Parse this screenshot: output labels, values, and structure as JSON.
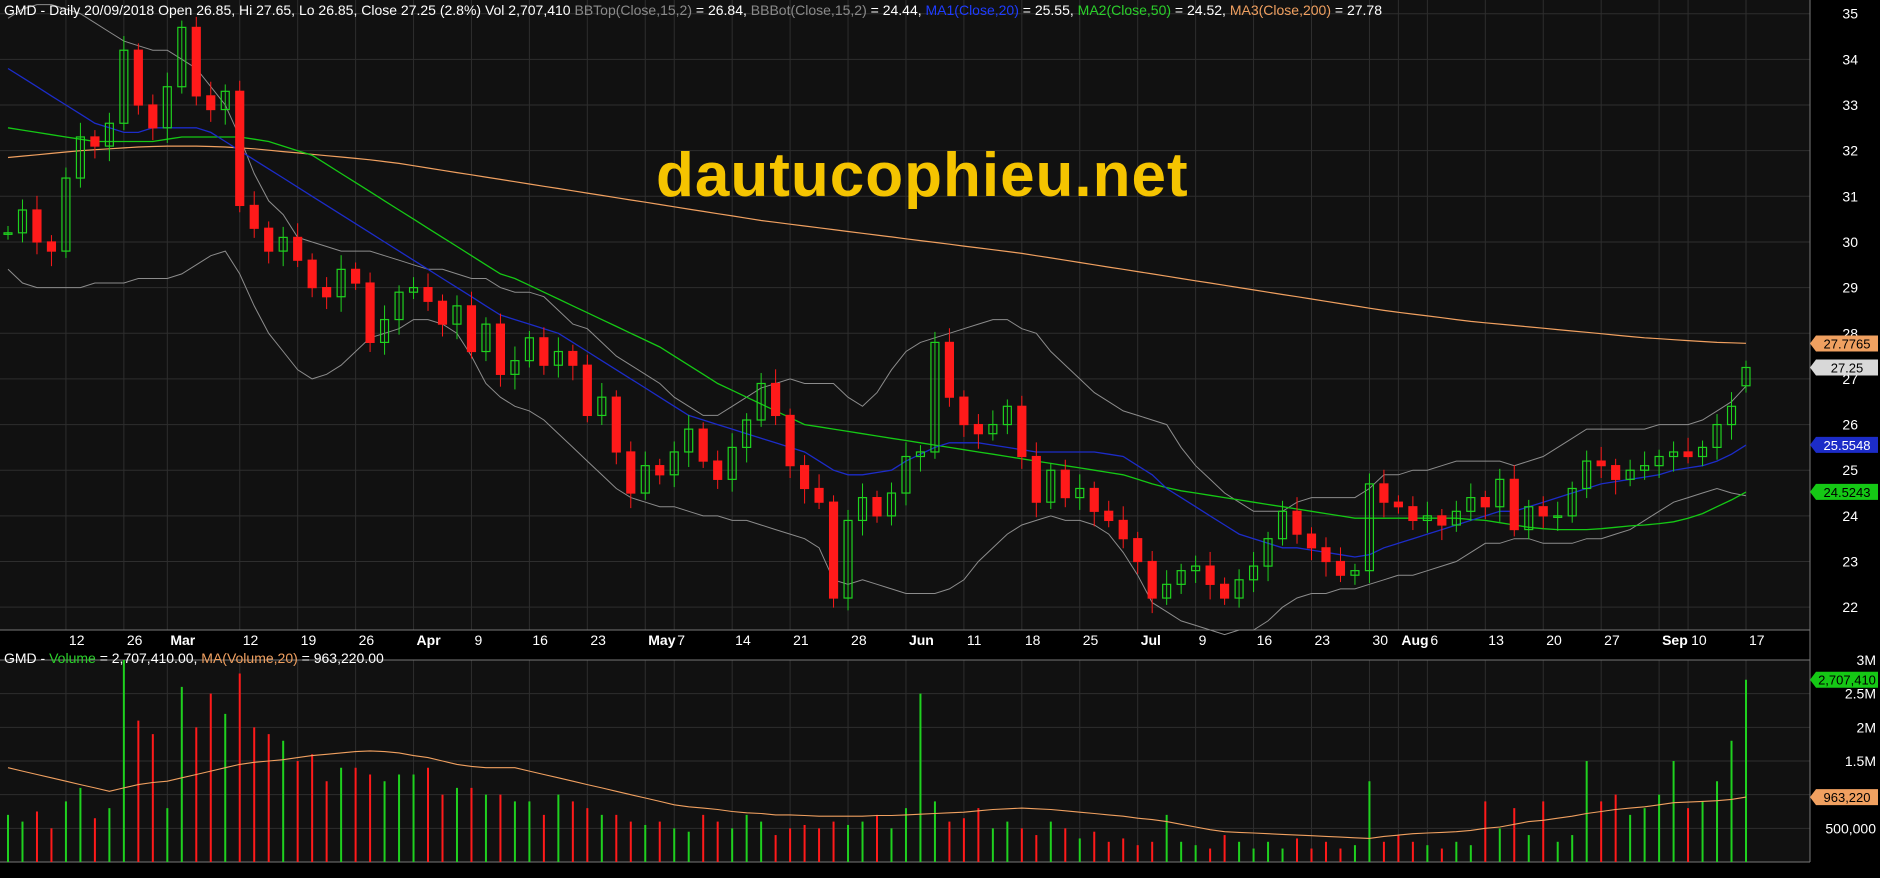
{
  "header": {
    "symbol_line": "GMD - Daily 20/09/2018 Open 26.85, Hi 27.65, Lo 26.85, Close 27.25 (2.8%) Vol 2,707,410",
    "bbtop_label": "BBTop(Close,15,2)",
    "bbtop_value": " = 26.84, ",
    "bbbot_label": "BBBot(Close,15,2)",
    "bbbot_value": " = 24.44, ",
    "ma1_label": "MA1(Close,20)",
    "ma1_value": " = 25.55, ",
    "ma2_label": "MA2(Close,50)",
    "ma2_value": " = 24.52, ",
    "ma3_label": "MA3(Close,200)",
    "ma3_value": " = 27.78"
  },
  "volume_header": {
    "symbol": "GMD - ",
    "volume_label": "Volume",
    "volume_value": " = 2,707,410.00, ",
    "ma_label": "MA(Volume,20)",
    "ma_value": " = 963,220.00"
  },
  "watermark": "dautucophieu.net",
  "colors": {
    "up": "#1fd11f",
    "down": "#ff1a1a",
    "bb": "#8c8c8c",
    "ma1": "#1c2cc8",
    "ma2": "#15c815",
    "ma3": "#f0a060",
    "vol_ma": "#f0a060",
    "grid": "#2e2e2e"
  },
  "chart_data": {
    "type": "candlestick",
    "price_axis": {
      "range": [
        21.5,
        35.3
      ],
      "ticks": [
        "22",
        "23",
        "24",
        "25",
        "26",
        "27",
        "28",
        "29",
        "30",
        "31",
        "32",
        "33",
        "34",
        "35"
      ]
    },
    "volume_axis": {
      "range": [
        0,
        3000000
      ],
      "ticks": [
        {
          "value": 500000,
          "label": "500,000"
        },
        {
          "value": 1000000,
          "label": "1M"
        },
        {
          "value": 1500000,
          "label": "1.5M"
        },
        {
          "value": 2000000,
          "label": "2M"
        },
        {
          "value": 2500000,
          "label": "2.5M"
        },
        {
          "value": 3000000,
          "label": "3M"
        }
      ]
    },
    "x_labels": [
      {
        "i": 4,
        "t": "12"
      },
      {
        "i": 8,
        "t": "26"
      },
      {
        "i": 11,
        "t": "Mar"
      },
      {
        "i": 16,
        "t": "12"
      },
      {
        "i": 20,
        "t": "19"
      },
      {
        "i": 24,
        "t": "26"
      },
      {
        "i": 28,
        "t": "Apr"
      },
      {
        "i": 32,
        "t": "9"
      },
      {
        "i": 36,
        "t": "16"
      },
      {
        "i": 40,
        "t": "23"
      },
      {
        "i": 44,
        "t": "May"
      },
      {
        "i": 46,
        "t": "7"
      },
      {
        "i": 50,
        "t": "14"
      },
      {
        "i": 54,
        "t": "21"
      },
      {
        "i": 58,
        "t": "28"
      },
      {
        "i": 62,
        "t": "Jun"
      },
      {
        "i": 66,
        "t": "11"
      },
      {
        "i": 70,
        "t": "18"
      },
      {
        "i": 74,
        "t": "25"
      },
      {
        "i": 78,
        "t": "Jul"
      },
      {
        "i": 82,
        "t": "9"
      },
      {
        "i": 86,
        "t": "16"
      },
      {
        "i": 90,
        "t": "23"
      },
      {
        "i": 94,
        "t": "30"
      },
      {
        "i": 96,
        "t": "Aug"
      },
      {
        "i": 98,
        "t": "6"
      },
      {
        "i": 102,
        "t": "13"
      },
      {
        "i": 106,
        "t": "20"
      },
      {
        "i": 110,
        "t": "27"
      },
      {
        "i": 114,
        "t": "Sep"
      },
      {
        "i": 116,
        "t": "10"
      },
      {
        "i": 120,
        "t": "17"
      }
    ],
    "close": [
      30.2,
      30.7,
      30.0,
      29.8,
      31.4,
      32.3,
      32.1,
      32.6,
      34.2,
      33.0,
      32.5,
      33.4,
      34.7,
      33.2,
      32.9,
      33.3,
      30.8,
      30.3,
      29.8,
      30.1,
      29.6,
      29.0,
      28.8,
      29.4,
      29.1,
      27.8,
      28.3,
      28.9,
      29.0,
      28.7,
      28.2,
      28.6,
      27.6,
      28.2,
      27.1,
      27.4,
      27.9,
      27.3,
      27.6,
      27.3,
      26.2,
      26.6,
      25.4,
      24.5,
      25.1,
      24.9,
      25.4,
      25.9,
      25.2,
      24.8,
      25.5,
      26.1,
      26.9,
      26.2,
      25.1,
      24.6,
      24.3,
      22.2,
      23.9,
      24.4,
      24.0,
      24.5,
      25.3,
      25.4,
      27.8,
      26.6,
      26.0,
      25.8,
      26.0,
      26.4,
      25.3,
      24.3,
      25.0,
      24.4,
      24.6,
      24.1,
      23.9,
      23.5,
      23.0,
      22.2,
      22.5,
      22.8,
      22.9,
      22.5,
      22.2,
      22.6,
      22.9,
      23.5,
      24.1,
      23.6,
      23.3,
      23.0,
      22.7,
      22.8,
      24.7,
      24.3,
      24.2,
      23.9,
      24.0,
      23.8,
      24.1,
      24.4,
      24.2,
      24.8,
      23.7,
      24.2,
      24.0,
      24.0,
      24.6,
      25.2,
      25.1,
      24.8,
      25.0,
      25.1,
      25.3,
      25.4,
      25.3,
      25.5,
      26.0,
      26.4,
      27.25
    ],
    "open": [
      null,
      30.2,
      30.7,
      30.0,
      29.8,
      31.4,
      32.3,
      32.1,
      32.6,
      34.2,
      33.0,
      32.5,
      33.4,
      34.7,
      33.2,
      32.9,
      33.3,
      30.8,
      30.3,
      29.8,
      30.1,
      29.6,
      29.0,
      28.8,
      29.4,
      29.1,
      27.8,
      28.3,
      28.9,
      29.0,
      28.7,
      28.2,
      28.6,
      27.6,
      28.2,
      27.1,
      27.4,
      27.9,
      27.3,
      27.6,
      27.3,
      26.2,
      26.6,
      25.4,
      24.5,
      25.1,
      24.9,
      25.4,
      25.9,
      25.2,
      24.8,
      25.5,
      26.1,
      26.9,
      26.2,
      25.1,
      24.6,
      24.3,
      22.2,
      23.9,
      24.4,
      24.0,
      24.5,
      25.3,
      25.4,
      27.8,
      26.6,
      26.0,
      25.8,
      26.0,
      26.4,
      25.3,
      24.3,
      25.0,
      24.4,
      24.6,
      24.1,
      23.9,
      23.5,
      23.0,
      22.2,
      22.5,
      22.8,
      22.9,
      22.5,
      22.2,
      22.6,
      22.9,
      23.5,
      24.1,
      23.6,
      23.3,
      23.0,
      22.7,
      22.8,
      24.7,
      24.3,
      24.2,
      23.9,
      24.0,
      23.8,
      24.1,
      24.4,
      24.2,
      24.8,
      23.7,
      24.2,
      24.0,
      24.0,
      24.6,
      25.2,
      25.1,
      24.8,
      25.0,
      25.1,
      25.3,
      25.4,
      25.3,
      25.5,
      26.0,
      26.85
    ],
    "bb_top": [
      34.9,
      35.1,
      35.2,
      35.2,
      35.1,
      35.0,
      34.8,
      34.6,
      34.4,
      34.3,
      34.2,
      34.2,
      34.0,
      33.8,
      33.4,
      33.0,
      32.3,
      31.5,
      30.9,
      30.6,
      30.1,
      30.0,
      29.9,
      29.8,
      29.8,
      29.8,
      29.7,
      29.6,
      29.5,
      29.4,
      29.4,
      29.3,
      29.2,
      29.2,
      29.0,
      28.9,
      28.9,
      28.8,
      28.5,
      28.2,
      28.1,
      27.8,
      27.5,
      27.3,
      27.1,
      26.9,
      26.6,
      26.4,
      26.2,
      26.2,
      26.4,
      26.6,
      26.8,
      26.9,
      27.0,
      26.9,
      26.9,
      26.9,
      26.6,
      26.4,
      26.7,
      27.2,
      27.6,
      27.8,
      27.9,
      28.0,
      28.1,
      28.2,
      28.3,
      28.3,
      28.1,
      28.0,
      27.6,
      27.3,
      27.0,
      26.7,
      26.5,
      26.3,
      26.2,
      26.1,
      26.0,
      25.5,
      25.1,
      24.8,
      24.5,
      24.3,
      24.1,
      24.1,
      24.1,
      24.3,
      24.4,
      24.4,
      24.4,
      24.4,
      24.6,
      24.9,
      24.9,
      25.0,
      25.0,
      25.1,
      25.2,
      25.2,
      25.2,
      25.2,
      25.1,
      25.2,
      25.3,
      25.5,
      25.7,
      25.9,
      25.9,
      25.9,
      25.9,
      25.9,
      26.0,
      26.0,
      26.0,
      26.1,
      26.3,
      26.5,
      26.84
    ],
    "bb_bot": [
      29.4,
      29.1,
      29.0,
      29.0,
      29.0,
      29.0,
      29.1,
      29.1,
      29.1,
      29.2,
      29.2,
      29.2,
      29.3,
      29.5,
      29.7,
      29.8,
      29.3,
      28.6,
      28.0,
      27.6,
      27.2,
      27.0,
      27.1,
      27.3,
      27.6,
      27.9,
      28.0,
      28.1,
      28.3,
      28.3,
      28.2,
      28.0,
      27.5,
      26.9,
      26.6,
      26.4,
      26.3,
      26.1,
      25.8,
      25.5,
      25.2,
      24.9,
      24.6,
      24.4,
      24.3,
      24.2,
      24.2,
      24.1,
      24.0,
      24.0,
      23.9,
      23.9,
      23.8,
      23.7,
      23.6,
      23.5,
      23.3,
      22.6,
      22.5,
      22.6,
      22.5,
      22.4,
      22.3,
      22.3,
      22.3,
      22.4,
      22.6,
      23.0,
      23.3,
      23.6,
      23.8,
      23.9,
      24.0,
      23.9,
      23.9,
      23.8,
      23.6,
      23.2,
      22.7,
      22.1,
      21.9,
      21.7,
      21.6,
      21.5,
      21.4,
      21.5,
      21.5,
      21.7,
      22.0,
      22.2,
      22.3,
      22.3,
      22.4,
      22.4,
      22.5,
      22.6,
      22.7,
      22.7,
      22.8,
      22.9,
      23.0,
      23.2,
      23.4,
      23.4,
      23.5,
      23.5,
      23.4,
      23.4,
      23.4,
      23.5,
      23.5,
      23.6,
      23.7,
      23.9,
      24.1,
      24.3,
      24.4,
      24.5,
      24.6,
      24.5,
      24.44
    ],
    "ma1": [
      33.8,
      33.6,
      33.4,
      33.2,
      33.0,
      32.8,
      32.6,
      32.5,
      32.4,
      32.4,
      32.5,
      32.5,
      32.5,
      32.5,
      32.4,
      32.2,
      32.0,
      31.8,
      31.6,
      31.4,
      31.2,
      31.0,
      30.8,
      30.6,
      30.4,
      30.2,
      30.0,
      29.8,
      29.6,
      29.4,
      29.2,
      29.0,
      28.8,
      28.6,
      28.4,
      28.3,
      28.2,
      28.1,
      28.0,
      27.8,
      27.6,
      27.4,
      27.2,
      27.0,
      26.8,
      26.6,
      26.4,
      26.2,
      26.1,
      26.0,
      25.9,
      25.8,
      25.7,
      25.6,
      25.5,
      25.4,
      25.2,
      25.0,
      24.9,
      24.9,
      24.95,
      25.0,
      25.2,
      25.35,
      25.5,
      25.6,
      25.6,
      25.6,
      25.55,
      25.5,
      25.45,
      25.4,
      25.4,
      25.4,
      25.4,
      25.4,
      25.35,
      25.3,
      25.1,
      24.9,
      24.6,
      24.4,
      24.2,
      24.0,
      23.8,
      23.6,
      23.5,
      23.4,
      23.3,
      23.3,
      23.25,
      23.2,
      23.15,
      23.1,
      23.15,
      23.3,
      23.4,
      23.5,
      23.6,
      23.7,
      23.8,
      23.9,
      24.0,
      24.1,
      24.1,
      24.2,
      24.3,
      24.4,
      24.5,
      24.6,
      24.7,
      24.75,
      24.8,
      24.85,
      24.9,
      25.0,
      25.05,
      25.1,
      25.2,
      25.35,
      25.55
    ],
    "ma2": [
      32.5,
      32.45,
      32.4,
      32.35,
      32.3,
      32.25,
      32.2,
      32.2,
      32.2,
      32.2,
      32.2,
      32.25,
      32.3,
      32.3,
      32.3,
      32.3,
      32.3,
      32.25,
      32.2,
      32.1,
      32.0,
      31.9,
      31.7,
      31.5,
      31.3,
      31.1,
      30.9,
      30.7,
      30.5,
      30.3,
      30.1,
      29.9,
      29.7,
      29.5,
      29.3,
      29.2,
      29.05,
      28.9,
      28.75,
      28.6,
      28.45,
      28.3,
      28.15,
      28.0,
      27.85,
      27.7,
      27.5,
      27.3,
      27.1,
      26.9,
      26.75,
      26.6,
      26.45,
      26.3,
      26.15,
      26.0,
      25.95,
      25.9,
      25.85,
      25.8,
      25.75,
      25.7,
      25.65,
      25.6,
      25.55,
      25.5,
      25.45,
      25.4,
      25.35,
      25.3,
      25.25,
      25.2,
      25.15,
      25.1,
      25.05,
      25.0,
      24.95,
      24.9,
      24.8,
      24.7,
      24.62,
      24.55,
      24.5,
      24.45,
      24.4,
      24.35,
      24.3,
      24.25,
      24.2,
      24.15,
      24.1,
      24.05,
      24.0,
      23.95,
      23.95,
      23.95,
      23.95,
      23.95,
      23.95,
      23.95,
      23.95,
      23.92,
      23.9,
      23.85,
      23.8,
      23.75,
      23.72,
      23.7,
      23.7,
      23.7,
      23.72,
      23.75,
      23.78,
      23.8,
      23.83,
      23.87,
      23.95,
      24.05,
      24.2,
      24.35,
      24.52
    ],
    "ma3": [
      31.85,
      31.88,
      31.91,
      31.94,
      31.97,
      32.0,
      32.02,
      32.04,
      32.06,
      32.08,
      32.09,
      32.1,
      32.1,
      32.1,
      32.09,
      32.08,
      32.06,
      32.04,
      32.01,
      31.98,
      31.95,
      31.92,
      31.89,
      31.86,
      31.83,
      31.8,
      31.76,
      31.72,
      31.67,
      31.62,
      31.57,
      31.52,
      31.47,
      31.42,
      31.37,
      31.32,
      31.27,
      31.22,
      31.17,
      31.12,
      31.07,
      31.02,
      30.97,
      30.92,
      30.87,
      30.82,
      30.77,
      30.72,
      30.67,
      30.62,
      30.57,
      30.52,
      30.47,
      30.43,
      30.39,
      30.35,
      30.31,
      30.27,
      30.23,
      30.19,
      30.15,
      30.11,
      30.07,
      30.03,
      29.99,
      29.95,
      29.91,
      29.87,
      29.83,
      29.79,
      29.75,
      29.7,
      29.65,
      29.6,
      29.55,
      29.5,
      29.45,
      29.4,
      29.35,
      29.3,
      29.25,
      29.2,
      29.15,
      29.1,
      29.05,
      29.0,
      28.95,
      28.9,
      28.85,
      28.8,
      28.75,
      28.7,
      28.65,
      28.6,
      28.55,
      28.5,
      28.46,
      28.42,
      28.38,
      28.34,
      28.3,
      28.26,
      28.23,
      28.2,
      28.17,
      28.14,
      28.11,
      28.08,
      28.05,
      28.02,
      27.99,
      27.96,
      27.93,
      27.9,
      27.88,
      27.86,
      27.84,
      27.82,
      27.8,
      27.79,
      27.78
    ],
    "volume": [
      700000,
      600000,
      750000,
      500000,
      900000,
      1100000,
      650000,
      800000,
      3000000,
      2100000,
      1900000,
      800000,
      2600000,
      2000000,
      2500000,
      2200000,
      2800000,
      2000000,
      1900000,
      1800000,
      1500000,
      1600000,
      1200000,
      1400000,
      1400000,
      1300000,
      1200000,
      1300000,
      1300000,
      1400000,
      1000000,
      1100000,
      1100000,
      1000000,
      1000000,
      900000,
      900000,
      700000,
      1000000,
      900000,
      800000,
      700000,
      700000,
      600000,
      550000,
      600000,
      500000,
      450000,
      700000,
      600000,
      500000,
      700000,
      600000,
      400000,
      500000,
      550000,
      500000,
      600000,
      550000,
      600000,
      700000,
      500000,
      800000,
      2500000,
      900000,
      600000,
      650000,
      800000,
      500000,
      600000,
      500000,
      400000,
      600000,
      500000,
      350000,
      450000,
      300000,
      350000,
      250000,
      300000,
      700000,
      300000,
      250000,
      200000,
      400000,
      300000,
      200000,
      300000,
      200000,
      350000,
      200000,
      300000,
      200000,
      250000,
      1200000,
      300000,
      400000,
      300000,
      250000,
      200000,
      300000,
      250000,
      900000,
      500000,
      800000,
      400000,
      900000,
      300000,
      400000,
      1500000,
      900000,
      1000000,
      700000,
      800000,
      1000000,
      1500000,
      800000,
      900000,
      1200000,
      1800000,
      2707410
    ],
    "vol_ma": [
      1400000,
      1350000,
      1300000,
      1250000,
      1200000,
      1150000,
      1100000,
      1050000,
      1100000,
      1150000,
      1180000,
      1200000,
      1250000,
      1300000,
      1350000,
      1400000,
      1450000,
      1480000,
      1500000,
      1520000,
      1550000,
      1580000,
      1600000,
      1620000,
      1640000,
      1650000,
      1640000,
      1620000,
      1580000,
      1550000,
      1500000,
      1450000,
      1420000,
      1400000,
      1400000,
      1400000,
      1350000,
      1300000,
      1250000,
      1200000,
      1150000,
      1100000,
      1050000,
      1000000,
      950000,
      900000,
      850000,
      820000,
      800000,
      780000,
      750000,
      730000,
      720000,
      700000,
      700000,
      690000,
      680000,
      680000,
      680000,
      680000,
      690000,
      690000,
      700000,
      710000,
      720000,
      730000,
      740000,
      760000,
      780000,
      790000,
      800000,
      790000,
      780000,
      760000,
      740000,
      720000,
      700000,
      680000,
      650000,
      630000,
      600000,
      560000,
      520000,
      480000,
      450000,
      440000,
      430000,
      420000,
      410000,
      400000,
      390000,
      380000,
      370000,
      360000,
      350000,
      380000,
      400000,
      420000,
      430000,
      440000,
      450000,
      470000,
      500000,
      520000,
      560000,
      600000,
      620000,
      650000,
      680000,
      720000,
      750000,
      780000,
      800000,
      820000,
      850000,
      880000,
      890000,
      900000,
      910000,
      930000,
      963220
    ],
    "markers": [
      {
        "label": "27.7765",
        "kind": "ma3",
        "value": 27.7765
      },
      {
        "label": "27.25",
        "kind": "last",
        "value": 27.25
      },
      {
        "label": "25.5548",
        "kind": "ma1",
        "value": 25.5548
      },
      {
        "label": "24.5243",
        "kind": "ma2",
        "value": 24.5243
      },
      {
        "label": "2,707,410",
        "kind": "vol",
        "value": 2707410
      },
      {
        "label": "963,220",
        "kind": "vol_ma",
        "value": 963220
      }
    ]
  }
}
